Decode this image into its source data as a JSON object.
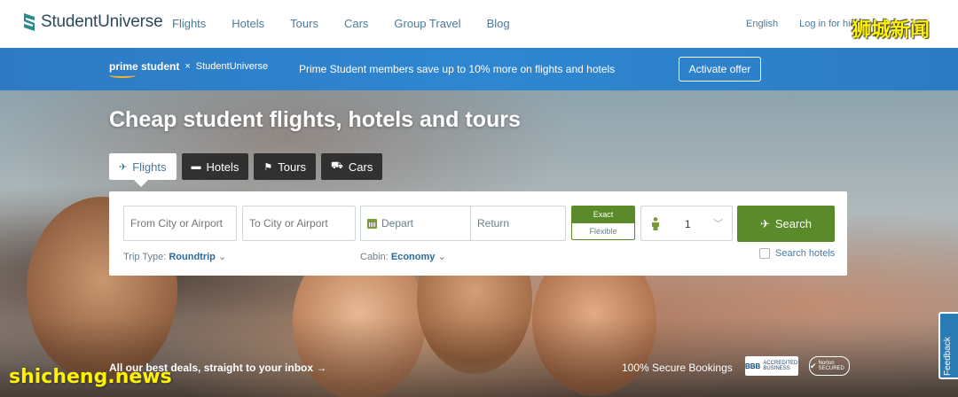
{
  "brand": {
    "name": "StudentUniverse"
  },
  "nav": {
    "items": [
      "Flights",
      "Hotels",
      "Tours",
      "Cars",
      "Group Travel",
      "Blog"
    ],
    "language": "English",
    "login": "Log in for hidd"
  },
  "watermarks": {
    "top": "狮城新闻",
    "bottom": "shicheng.news"
  },
  "banner": {
    "prime_label": "prime student",
    "times": "×",
    "partner": "StudentUniverse",
    "message": "Prime Student members save up to 10% more on flights and hotels",
    "cta": "Activate offer"
  },
  "hero": {
    "title": "Cheap student flights, hotels and tours",
    "tabs": [
      {
        "label": "Flights",
        "icon": "plane-icon",
        "active": true
      },
      {
        "label": "Hotels",
        "icon": "bed-icon",
        "active": false
      },
      {
        "label": "Tours",
        "icon": "flag-icon",
        "active": false
      },
      {
        "label": "Cars",
        "icon": "car-icon",
        "active": false
      }
    ]
  },
  "search": {
    "from_placeholder": "From City or Airport",
    "to_placeholder": "To City or Airport",
    "depart": "Depart",
    "return": "Return",
    "exact": "Exact",
    "flexible": "Flexible",
    "passengers": "1",
    "button": "Search",
    "trip_type_label": "Trip Type:",
    "trip_type_value": "Roundtrip",
    "cabin_label": "Cabin:",
    "cabin_value": "Economy",
    "search_hotels": "Search hotels",
    "search_hotels_checked": false
  },
  "footer": {
    "deals": "All our best deals, straight to your inbox →",
    "secure": "100% Secure Bookings",
    "bbb": "ACCREDITED BUSINESS",
    "norton": "Norton SECURED"
  },
  "feedback": "Feedback",
  "colors": {
    "primary_blue": "#2e7bc4",
    "green": "#5b8a2a",
    "link": "#4a7a9a"
  }
}
